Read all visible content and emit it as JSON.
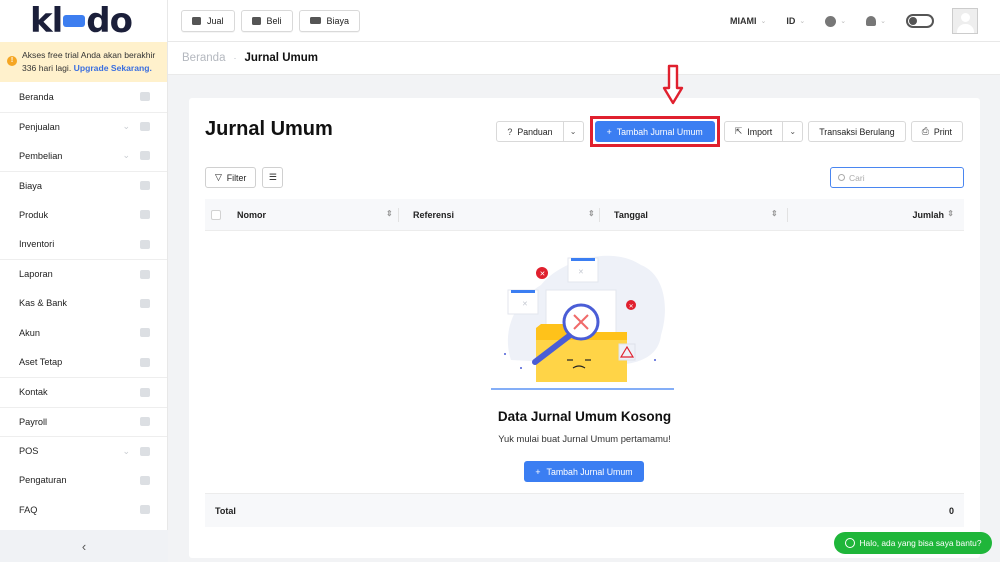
{
  "brand": {
    "logo_text_pre": "kl",
    "logo_text_post": "do",
    "accent": "#3b7ef2"
  },
  "trial": {
    "message": "Akses free trial Anda akan berakhir 336 hari lagi.",
    "upgrade_label": "Upgrade Sekarang."
  },
  "sidebar": {
    "items": [
      {
        "label": "Beranda",
        "icon": "home-icon",
        "has_caret": false
      },
      {
        "label": "Penjualan",
        "icon": "basket-icon",
        "has_caret": true
      },
      {
        "label": "Pembelian",
        "icon": "bag-icon",
        "has_caret": true
      },
      {
        "label": "Biaya",
        "icon": "card-icon",
        "has_caret": false
      },
      {
        "label": "Produk",
        "icon": "box-icon",
        "has_caret": false
      },
      {
        "label": "Inventori",
        "icon": "warehouse-icon",
        "has_caret": false
      },
      {
        "label": "Laporan",
        "icon": "chart-icon",
        "has_caret": false
      },
      {
        "label": "Kas & Bank",
        "icon": "dollar-icon",
        "has_caret": false
      },
      {
        "label": "Akun",
        "icon": "ledger-icon",
        "has_caret": false
      },
      {
        "label": "Aset Tetap",
        "icon": "building-icon",
        "has_caret": false
      },
      {
        "label": "Kontak",
        "icon": "contact-icon",
        "has_caret": false
      },
      {
        "label": "Payroll",
        "icon": "payroll-icon",
        "has_caret": false
      },
      {
        "label": "POS",
        "icon": "pos-icon",
        "has_caret": true
      },
      {
        "label": "Pengaturan",
        "icon": "settings-icon",
        "has_caret": false
      },
      {
        "label": "FAQ",
        "icon": "question-icon",
        "has_caret": false
      }
    ],
    "collapse_glyph": "‹"
  },
  "topbar": {
    "quick": [
      {
        "label": "Jual"
      },
      {
        "label": "Beli"
      },
      {
        "label": "Biaya"
      }
    ],
    "company": "MIAMI",
    "language": "ID"
  },
  "breadcrumb": {
    "home": "Beranda",
    "current": "Jurnal Umum"
  },
  "page": {
    "title": "Jurnal Umum",
    "actions": {
      "guide": "Panduan",
      "add": "Tambah Jurnal Umum",
      "import": "Import",
      "recurring": "Transaksi Berulang",
      "print": "Print"
    },
    "filter_label": "Filter",
    "search_placeholder": "Cari",
    "table": {
      "columns": [
        "Nomor",
        "Referensi",
        "Tanggal",
        "Jumlah"
      ],
      "rows": []
    },
    "empty": {
      "title": "Data Jurnal Umum Kosong",
      "subtitle": "Yuk mulai buat Jurnal Umum pertamamu!",
      "button": "Tambah Jurnal Umum"
    },
    "total": {
      "label": "Total",
      "value": "0"
    }
  },
  "chat": {
    "label": "Halo, ada yang bisa saya bantu?"
  },
  "colors": {
    "highlight_box": "#e0202e",
    "primary": "#3b7ef2",
    "chat": "#1fb63a",
    "trial_bg": "#fff1cc"
  }
}
